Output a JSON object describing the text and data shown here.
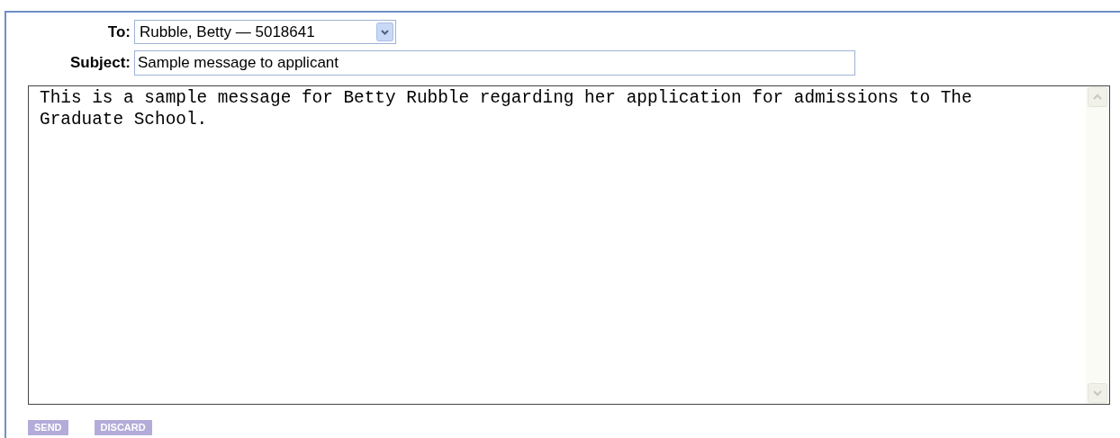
{
  "to": {
    "label": "To:",
    "value": "Rubble, Betty — 5018641"
  },
  "subject": {
    "label": "Subject:",
    "value": "Sample message to applicant"
  },
  "message": {
    "value": "This is a sample message for Betty Rubble regarding her application for admissions to The Graduate School."
  },
  "buttons": [
    {
      "label": "SEND"
    },
    {
      "label": "DISCARD"
    }
  ]
}
